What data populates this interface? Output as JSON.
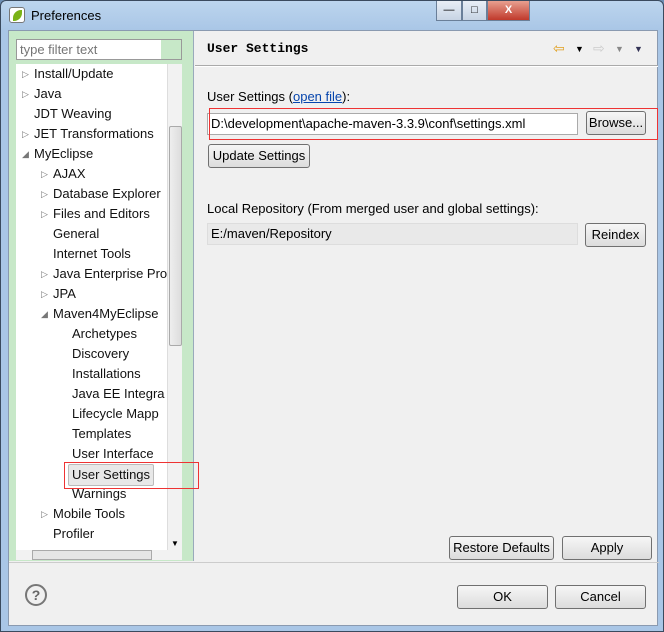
{
  "window": {
    "title": "Preferences",
    "minimize": "—",
    "maximize": "□",
    "close": "X"
  },
  "filter": {
    "placeholder": "type filter text"
  },
  "tree": [
    {
      "label": "Install/Update",
      "level": 0,
      "expandable": true
    },
    {
      "label": "Java",
      "level": 0,
      "expandable": true
    },
    {
      "label": "JDT Weaving",
      "level": 0,
      "expandable": false
    },
    {
      "label": "JET Transformations",
      "level": 0,
      "expandable": true
    },
    {
      "label": "MyEclipse",
      "level": 0,
      "expanded": true
    },
    {
      "label": "AJAX",
      "level": 1,
      "expandable": true
    },
    {
      "label": "Database Explorer",
      "level": 1,
      "expandable": true
    },
    {
      "label": "Files and Editors",
      "level": 1,
      "expandable": true
    },
    {
      "label": "General",
      "level": 1,
      "expandable": false
    },
    {
      "label": "Internet Tools",
      "level": 1,
      "expandable": false
    },
    {
      "label": "Java Enterprise Pro",
      "level": 1,
      "expandable": true
    },
    {
      "label": "JPA",
      "level": 1,
      "expandable": true
    },
    {
      "label": "Maven4MyEclipse",
      "level": 1,
      "expanded": true
    },
    {
      "label": "Archetypes",
      "level": 2
    },
    {
      "label": "Discovery",
      "level": 2
    },
    {
      "label": "Installations",
      "level": 2
    },
    {
      "label": "Java EE Integra",
      "level": 2
    },
    {
      "label": "Lifecycle Mapp",
      "level": 2
    },
    {
      "label": "Templates",
      "level": 2
    },
    {
      "label": "User Interface",
      "level": 2
    },
    {
      "label": "User Settings",
      "level": 2,
      "selected": true
    },
    {
      "label": "Warnings",
      "level": 2
    },
    {
      "label": "Mobile Tools",
      "level": 1,
      "expandable": true
    },
    {
      "label": "Profiler",
      "level": 1,
      "expandable": false
    }
  ],
  "page": {
    "title": "User Settings",
    "user_settings_label": "User Settings (",
    "open_file_link": "open file",
    "user_settings_label_end": "):",
    "user_settings_value": "D:\\development\\apache-maven-3.3.9\\conf\\settings.xml",
    "browse": "Browse...",
    "update": "Update Settings",
    "local_repo_label": "Local Repository (From merged user and global settings):",
    "local_repo_value": "E:/maven/Repository",
    "reindex": "Reindex",
    "restore": "Restore Defaults",
    "apply": "Apply"
  },
  "footer": {
    "ok": "OK",
    "cancel": "Cancel",
    "help": "?"
  },
  "colors": {
    "accent_annotation": "#e33333",
    "left_bg": "#c7e8c8"
  }
}
